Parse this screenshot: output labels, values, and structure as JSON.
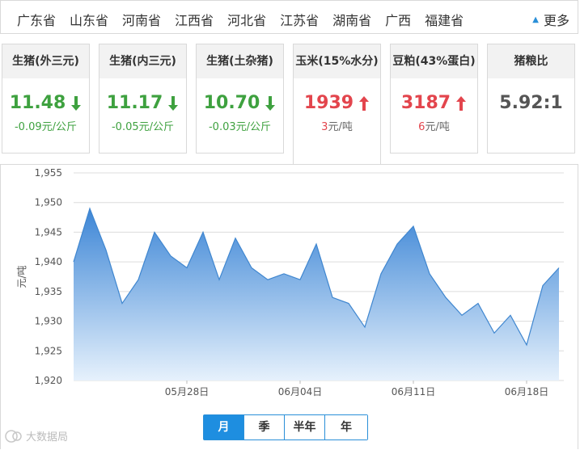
{
  "provinces": [
    "广东省",
    "山东省",
    "河南省",
    "江西省",
    "河北省",
    "江苏省",
    "湖南省",
    "广西",
    "福建省"
  ],
  "more_label": "更多",
  "cards": [
    {
      "title": "生猪(外三元)",
      "price": "11.48",
      "change": "-0.09元/公斤",
      "direction": "down"
    },
    {
      "title": "生猪(内三元)",
      "price": "11.17",
      "change": "-0.05元/公斤",
      "direction": "down"
    },
    {
      "title": "生猪(土杂猪)",
      "price": "10.70",
      "change": "-0.03元/公斤",
      "direction": "down"
    },
    {
      "title": "玉米(15%水分)",
      "price": "1939",
      "change_value": "3",
      "change_unit": "元/吨",
      "direction": "up"
    },
    {
      "title": "豆粕(43%蛋白)",
      "price": "3187",
      "change_value": "6",
      "change_unit": "元/吨",
      "direction": "up"
    },
    {
      "title": "猪粮比",
      "price": "5.92:1",
      "direction": "none"
    }
  ],
  "colors": {
    "down": "#3ea13f",
    "up": "#e3454d",
    "accent": "#1e8ee0",
    "line": "#3f86cf"
  },
  "range_tabs": [
    "月",
    "季",
    "半年",
    "年"
  ],
  "active_range": "月",
  "watermark": "大数据局",
  "chart_data": {
    "type": "area",
    "ylabel": "元/吨",
    "ylim": [
      1920,
      1955
    ],
    "yticks": [
      "1,955",
      "1,950",
      "1,945",
      "1,940",
      "1,935",
      "1,930",
      "1,925",
      "1,920"
    ],
    "xtick_labels": [
      {
        "index": 7,
        "label": "05月28日"
      },
      {
        "index": 14,
        "label": "06月04日"
      },
      {
        "index": 21,
        "label": "06月11日"
      },
      {
        "index": 28,
        "label": "06月18日"
      }
    ],
    "values": [
      1940,
      1949,
      1942,
      1933,
      1937,
      1945,
      1941,
      1939,
      1945,
      1937,
      1944,
      1939,
      1937,
      1938,
      1937,
      1943,
      1934,
      1933,
      1929,
      1938,
      1943,
      1946,
      1938,
      1934,
      1931,
      1933,
      1928,
      1931,
      1926,
      1936,
      1939
    ]
  }
}
